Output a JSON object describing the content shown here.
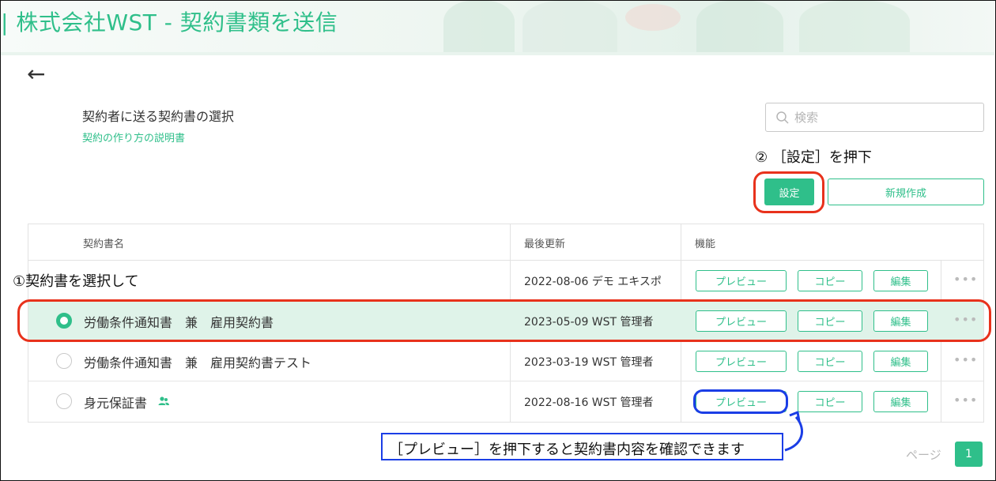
{
  "header": {
    "title": "| 株式会社WST - 契約書類を送信"
  },
  "section": {
    "title": "契約者に送る契約書の選択",
    "howto_link": "契約の作り方の説明書"
  },
  "search": {
    "placeholder": "検索"
  },
  "notes": {
    "step2": "② ［設定］を押下",
    "step1": "①契約書を選択して",
    "preview_callout": "［プレビュー］を押下すると契約書内容を確認できます"
  },
  "actions": {
    "settings_label": "設定",
    "new_label": "新規作成"
  },
  "table": {
    "headers": {
      "name": "契約書名",
      "updated": "最後更新",
      "functions": "機能"
    },
    "rows": [
      {
        "name": "",
        "updated": "2022-08-06 デモ エキスポ",
        "preview": "プレビュー",
        "copy": "コピー",
        "edit": "編集",
        "selected": false
      },
      {
        "name": "労働条件通知書　兼　雇用契約書",
        "updated": "2023-05-09 WST 管理者",
        "preview": "プレビュー",
        "copy": "コピー",
        "edit": "編集",
        "selected": true
      },
      {
        "name": "労働条件通知書　兼　雇用契約書テスト",
        "updated": "2023-03-19 WST 管理者",
        "preview": "プレビュー",
        "copy": "コピー",
        "edit": "編集",
        "selected": false
      },
      {
        "name": "身元保証書",
        "updated": "2022-08-16 WST 管理者",
        "preview": "プレビュー",
        "copy": "コピー",
        "edit": "編集",
        "selected": false,
        "icon": "users-icon"
      }
    ],
    "more_label": "•••"
  },
  "pagination": {
    "label": "ページ",
    "current": "1"
  },
  "colors": {
    "accent": "#2fbf8a",
    "annotation_red": "#e8321c",
    "annotation_blue": "#1b3ee6",
    "selected_row": "#dff3e9"
  }
}
